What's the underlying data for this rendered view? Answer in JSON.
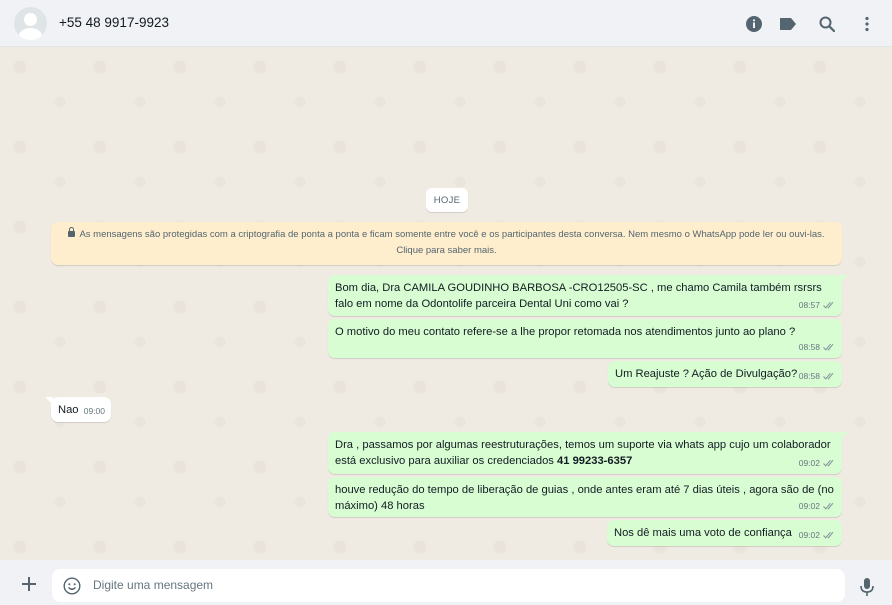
{
  "header": {
    "contact_name": "+55 48 9917-9923",
    "icons": [
      "info-icon",
      "label-icon",
      "search-icon",
      "menu-icon"
    ]
  },
  "chat": {
    "date_label": "HOJE",
    "encryption_notice": "As mensagens são protegidas com a criptografia de ponta a ponta e ficam somente entre você e os participantes desta conversa. Nem mesmo o WhatsApp pode ler ou ouvi-las. Clique para saber mais.",
    "messages": [
      {
        "direction": "out",
        "text": "Bom dia, Dra  CAMILA GOUDINHO BARBOSA -CRO12505-SC , me chamo Camila também rsrsrs falo em nome da Odontolife parceira Dental Uni como vai ?",
        "time": "08:57",
        "status": "read"
      },
      {
        "direction": "out",
        "text": "O motivo do meu contato refere-se a lhe propor retomada nos atendimentos junto ao plano ?",
        "time": "08:58",
        "status": "read"
      },
      {
        "direction": "out",
        "text": "Um Reajuste ? Ação de Divulgação?",
        "time": "08:58",
        "status": "read"
      },
      {
        "direction": "in",
        "text": "Nao",
        "time": "09:00"
      },
      {
        "direction": "out",
        "text": "Dra , passamos por algumas reestruturações, temos um suporte via whats app cujo um colaborador está exclusivo para auxiliar os credenciados ",
        "bold_text": "41 99233-6357",
        "time": "09:02",
        "status": "read"
      },
      {
        "direction": "out",
        "text": "houve redução do tempo de liberação de guias , onde antes eram até 7 dias úteis , agora são de (no máximo) 48 horas",
        "time": "09:02",
        "status": "read"
      },
      {
        "direction": "out",
        "text": "Nos dê mais uma voto de confiança",
        "time": "09:02",
        "status": "read"
      }
    ]
  },
  "composer": {
    "placeholder": "Digite uma mensagem"
  },
  "colors": {
    "header_bg": "#f0f2f5",
    "chat_bg": "#efeae2",
    "outgoing_bubble": "#d9fdd3",
    "incoming_bubble": "#ffffff",
    "notice_bg": "#ffeecd",
    "icon": "#54656f",
    "read_tick": "#8696a0"
  }
}
